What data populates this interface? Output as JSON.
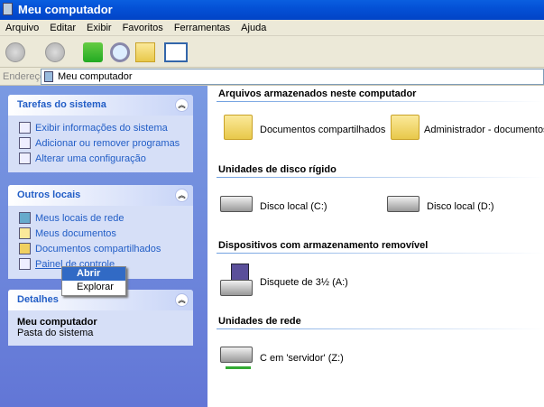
{
  "window": {
    "title": "Meu computador"
  },
  "menu": [
    "Arquivo",
    "Editar",
    "Exibir",
    "Favoritos",
    "Ferramentas",
    "Ajuda"
  ],
  "address": {
    "label": "Endereço",
    "value": "Meu computador"
  },
  "panels": {
    "system_tasks": {
      "title": "Tarefas do sistema",
      "items": [
        "Exibir informações do sistema",
        "Adicionar ou remover programas",
        "Alterar uma configuração"
      ]
    },
    "other_places": {
      "title": "Outros locais",
      "items": [
        "Meus locais de rede",
        "Meus documentos",
        "Documentos compartilhados",
        "Painel de controle"
      ]
    },
    "details": {
      "title": "Detalhes",
      "name": "Meu computador",
      "desc": "Pasta do sistema"
    }
  },
  "context_menu": [
    "Abrir",
    "Explorar"
  ],
  "sections": {
    "stored": {
      "title": "Arquivos armazenados neste computador",
      "items": [
        "Documentos compartilhados",
        "Administrador - documentos"
      ]
    },
    "hdd": {
      "title": "Unidades de disco rígido",
      "items": [
        "Disco local (C:)",
        "Disco local (D:)"
      ]
    },
    "removable": {
      "title": "Dispositivos com armazenamento removível",
      "items": [
        "Disquete de 3½ (A:)"
      ]
    },
    "network": {
      "title": "Unidades de rede",
      "items": [
        "C em 'servidor' (Z:)"
      ]
    }
  }
}
